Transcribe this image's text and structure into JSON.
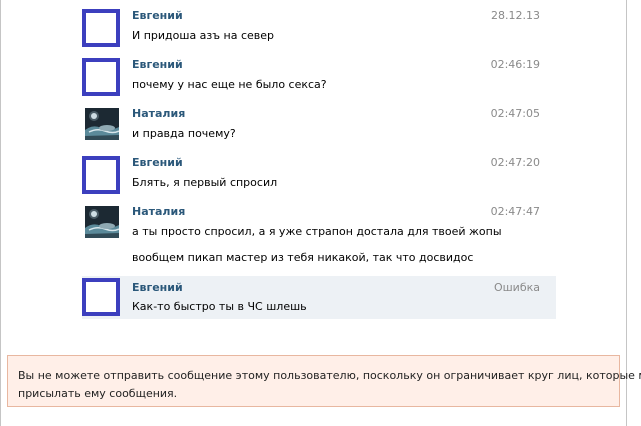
{
  "messages": [
    {
      "author": "Евгений",
      "time": "28.12.13",
      "avatar": "blank-avatar",
      "lines": [
        "И придоша азъ на север"
      ]
    },
    {
      "author": "Евгений",
      "time": "02:46:19",
      "avatar": "blank-avatar",
      "lines": [
        "почему у нас еще не было секса?"
      ]
    },
    {
      "author": "Наталия",
      "time": "02:47:05",
      "avatar": "photo-avatar",
      "lines": [
        "и правда почему?"
      ]
    },
    {
      "author": "Евгений",
      "time": "02:47:20",
      "avatar": "blank-avatar",
      "lines": [
        "Блять, я первый спросил"
      ]
    },
    {
      "author": "Наталия",
      "time": "02:47:47",
      "avatar": "photo-avatar",
      "lines": [
        "а ты просто спросил, а я уже страпон достала для твоей жопы",
        "вообщем пикап мастер из тебя никакой, так что досвидос"
      ]
    },
    {
      "author": "Евгений",
      "time": "Ошибка",
      "avatar": "blank-avatar",
      "status": "error",
      "lines": [
        "Как-то быстро ты в ЧС шлешь"
      ]
    }
  ],
  "notice": {
    "line1": "Вы не можете отправить сообщение этому пользователю, поскольку он ограничивает круг лиц, которые могут",
    "line2": "присылать ему сообщения."
  },
  "colors": {
    "author": "#2b587a",
    "avatar_border": "#3c3fbe",
    "error_row_bg": "#edf1f5",
    "notice_bg": "#ffefe8",
    "notice_border": "#e8b7a0"
  }
}
